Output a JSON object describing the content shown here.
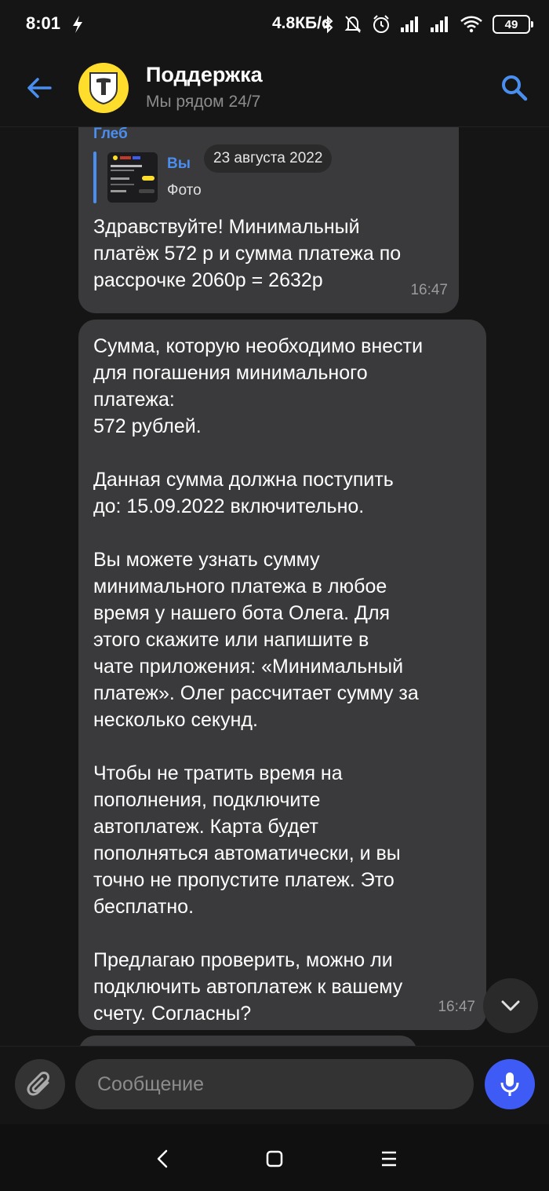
{
  "status_bar": {
    "time": "8:01",
    "network_speed": "4.8КБ/с",
    "battery": "49",
    "icons": [
      "bolt-icon",
      "bluetooth-icon",
      "bell-off-icon",
      "alarm-icon",
      "signal-icon",
      "signal-icon",
      "wifi-icon",
      "battery-icon"
    ]
  },
  "header": {
    "title": "Поддержка",
    "subtitle": "Мы рядом 24/7",
    "brand_color": "#ffdd2d",
    "accent_color": "#4a8ef0"
  },
  "date_separator": "23 августа 2022",
  "messages": [
    {
      "sender": "Глеб",
      "reply_to": {
        "name": "Вы",
        "type": "Фото"
      },
      "text": "Здравствуйте! Минимальный\nплатёж 572 р и сумма платежа по\nрассрочке 2060р = 2632р",
      "time": "16:47"
    },
    {
      "text": "Сумма, которую необходимо внести\nдля погашения минимального\nплатежа:\n572 рублей.\n\nДанная сумма должна поступить\nдо: 15.09.2022 включительно.\n\nВы можете узнать сумму\nминимального платежа в любое\nвремя у нашего бота Олега. Для\nэтого скажите или напишите в\nчате приложения: «Минимальный\nплатеж». Олег рассчитает сумму за\nнесколько секунд.\n\nЧтобы не тратить время на\nпополнения, подключите\nавтоплатеж. Карта будет\nпополняться автоматически, и вы\nточно не пропустите платеж. Это\nбесплатно.\n\nПредлагаю проверить, можно ли\nподключить автоплатеж к вашему\nсчету. Согласны?",
      "time": "16:47"
    }
  ],
  "input": {
    "placeholder": "Сообщение"
  },
  "mic_color": "#3f5bf5"
}
